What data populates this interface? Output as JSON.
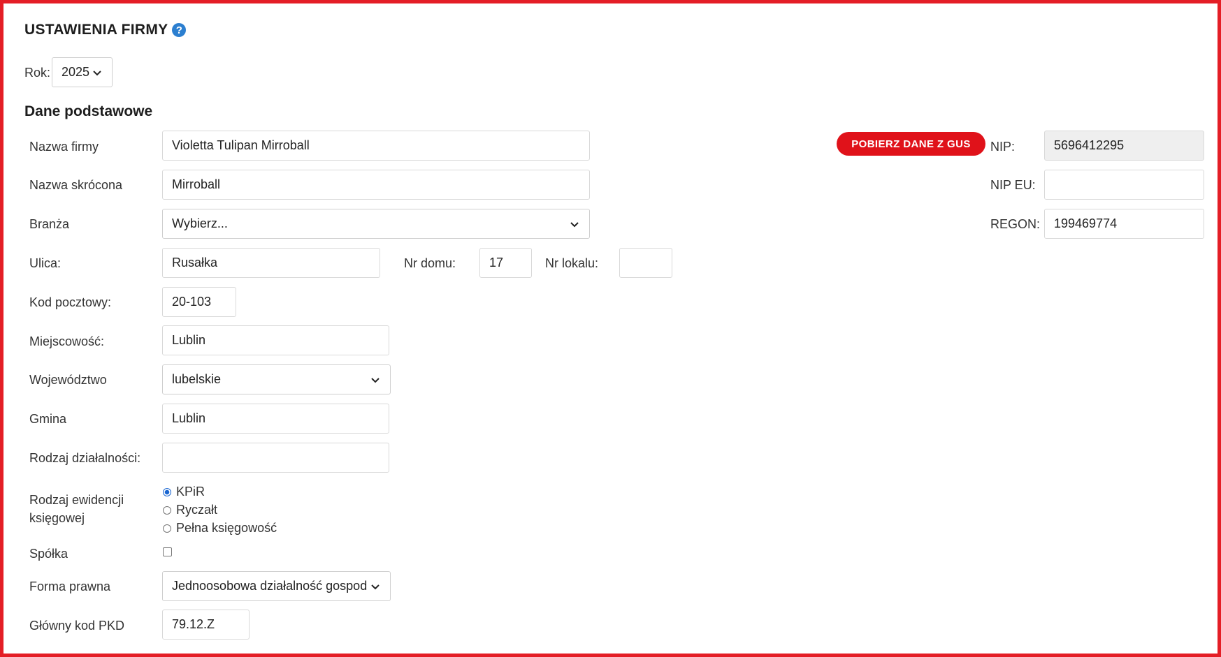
{
  "header": {
    "title": "USTAWIENIA FIRMY",
    "help_icon": "question-circle-icon",
    "help_glyph": "?"
  },
  "year": {
    "label": "Rok:",
    "value": "2025"
  },
  "section_title": "Dane podstawowe",
  "gus_button": "POBIERZ DANE Z GUS",
  "fields": {
    "nazwa_firmy": {
      "label": "Nazwa firmy",
      "value": "Violetta Tulipan Mirroball"
    },
    "nazwa_skrocona": {
      "label": "Nazwa skrócona",
      "value": "Mirroball"
    },
    "branza": {
      "label": "Branża",
      "value": "Wybierz..."
    },
    "ulica": {
      "label": "Ulica:",
      "value": "Rusałka"
    },
    "nr_domu": {
      "label": "Nr domu:",
      "value": "17"
    },
    "nr_lokalu": {
      "label": "Nr lokalu:",
      "value": ""
    },
    "kod_pocztowy": {
      "label": "Kod pocztowy:",
      "value": "20-103"
    },
    "miejscowosc": {
      "label": "Miejscowość:",
      "value": "Lublin"
    },
    "wojewodztwo": {
      "label": "Województwo",
      "value": "lubelskie"
    },
    "gmina": {
      "label": "Gmina",
      "value": "Lublin"
    },
    "rodzaj_dzialalnosci": {
      "label": "Rodzaj działalności:",
      "value": ""
    },
    "rodzaj_ewidencji": {
      "label_line1": "Rodzaj ewidencji",
      "label_line2": "księgowej",
      "options": [
        "KPiR",
        "Ryczałt",
        "Pełna księgowość"
      ],
      "selected": "KPiR"
    },
    "spolka": {
      "label": "Spółka",
      "checked": false
    },
    "forma_prawna": {
      "label": "Forma prawna",
      "value": "Jednoosobowa działalność gospod"
    },
    "glowny_kod_pkd": {
      "label": "Główny kod PKD",
      "value": "79.12.Z"
    },
    "nip": {
      "label": "NIP:",
      "value": "5696412295"
    },
    "nip_eu": {
      "label": "NIP EU:",
      "value": ""
    },
    "regon": {
      "label": "REGON:",
      "value": "199469774"
    }
  },
  "colors": {
    "accent": "#e41e26",
    "button": "#e0121a",
    "help": "#2c7fd0",
    "radio": "#1a66d1"
  }
}
